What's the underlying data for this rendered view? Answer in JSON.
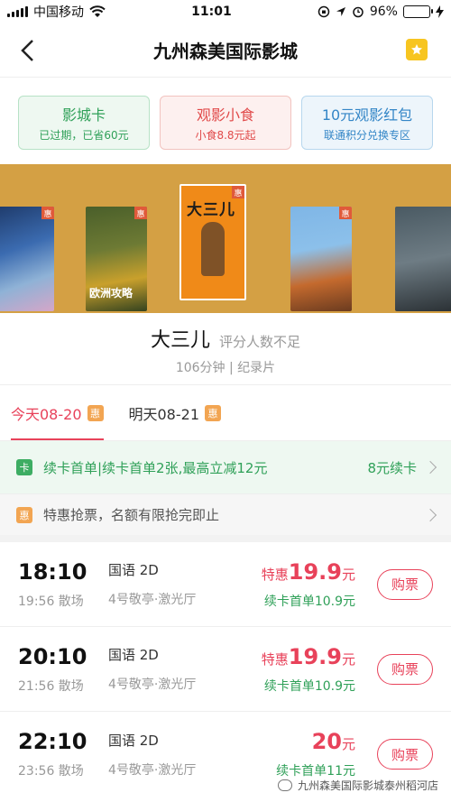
{
  "status_bar": {
    "carrier": "中国移动",
    "time": "11:01",
    "battery": "96%"
  },
  "header": {
    "title": "九州森美国际影城"
  },
  "cards": [
    {
      "title": "影城卡",
      "subtitle": "已过期，已省60元"
    },
    {
      "title": "观影小食",
      "subtitle": "小食8.8元起"
    },
    {
      "title": "10元观影红包",
      "subtitle": "联通积分兑换专区"
    }
  ],
  "posters": {
    "selected_title": "大三儿",
    "tag": "惠",
    "other_titles": [
      "欧洲攻略"
    ]
  },
  "movie": {
    "name": "大三儿",
    "score": "评分人数不足",
    "meta": "106分钟 | 纪录片"
  },
  "tabs": [
    {
      "label": "今天08-20",
      "badge": "惠"
    },
    {
      "label": "明天08-21",
      "badge": "惠"
    }
  ],
  "promos": {
    "card": {
      "badge": "卡",
      "text": "续卡首单|续卡首单2张,最高立减12元",
      "right": "8元续卡"
    },
    "deal": {
      "badge": "惠",
      "text": "特惠抢票，名额有限抢完即止"
    }
  },
  "showtimes": [
    {
      "start": "18:10",
      "end": "19:56 散场",
      "lang": "国语 2D",
      "hall": "4号敬亭·激光厅",
      "price_label": "特惠",
      "price": "19.9",
      "unit": "元",
      "card_price": "续卡首单10.9元",
      "buy": "购票"
    },
    {
      "start": "20:10",
      "end": "21:56 散场",
      "lang": "国语 2D",
      "hall": "4号敬亭·激光厅",
      "price_label": "特惠",
      "price": "19.9",
      "unit": "元",
      "card_price": "续卡首单10.9元",
      "buy": "购票"
    },
    {
      "start": "22:10",
      "end": "23:56 散场",
      "lang": "国语 2D",
      "hall": "4号敬亭·激光厅",
      "price_label": "",
      "price": "20",
      "unit": "元",
      "card_price": "续卡首单11元",
      "buy": "购票"
    }
  ],
  "watermark": "九州森美国际影城泰州稻河店"
}
